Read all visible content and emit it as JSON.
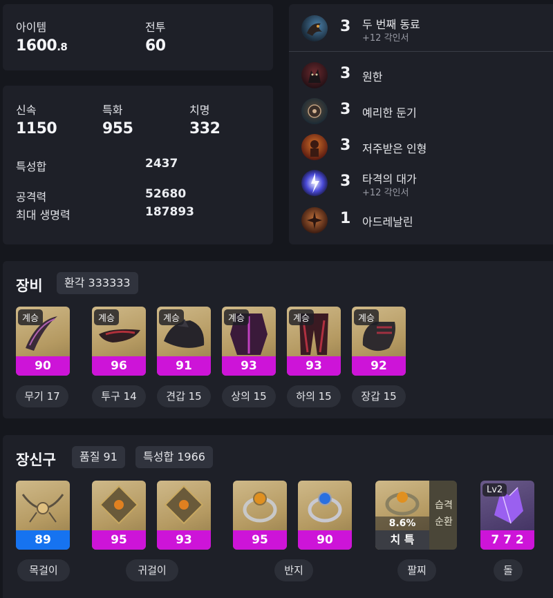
{
  "summary": {
    "item_level_label": "아이템",
    "item_level_main": "1600",
    "item_level_frac": ".8",
    "combat_label": "전투",
    "combat_value": "60"
  },
  "stats": {
    "swiftness_label": "신속",
    "swiftness_value": "1150",
    "specialization_label": "특화",
    "specialization_value": "955",
    "crit_label": "치명",
    "crit_value": "332",
    "total_label": "특성합",
    "total_value": "2437",
    "attack_label": "공격력",
    "attack_value": "52680",
    "hp_label": "최대 생명력",
    "hp_value": "187893"
  },
  "engravings": [
    {
      "level": "3",
      "name": "두 번째 동료",
      "sub": "+12 각인서"
    },
    {
      "level": "3",
      "name": "원한",
      "sub": ""
    },
    {
      "level": "3",
      "name": "예리한 둔기",
      "sub": ""
    },
    {
      "level": "3",
      "name": "저주받은 인형",
      "sub": ""
    },
    {
      "level": "3",
      "name": "타격의 대가",
      "sub": "+12 각인서"
    },
    {
      "level": "1",
      "name": "아드레날린",
      "sub": ""
    }
  ],
  "equipment": {
    "title": "장비",
    "chip": "환각 333333",
    "items": [
      {
        "tag": "계승",
        "quality": "90",
        "label": "무기 17"
      },
      {
        "tag": "계승",
        "quality": "96",
        "label": "투구 14"
      },
      {
        "tag": "계승",
        "quality": "91",
        "label": "견갑 15"
      },
      {
        "tag": "계승",
        "quality": "93",
        "label": "상의 15"
      },
      {
        "tag": "계승",
        "quality": "93",
        "label": "하의 15"
      },
      {
        "tag": "계승",
        "quality": "92",
        "label": "장갑 15"
      }
    ]
  },
  "accessories": {
    "title": "장신구",
    "chip_quality": "품질 91",
    "chip_total": "특성합 1966",
    "necklace": {
      "quality": "89",
      "label": "목걸이"
    },
    "earring1": {
      "quality": "95"
    },
    "earring2": {
      "quality": "93"
    },
    "earring_label": "귀걸이",
    "ring1": {
      "quality": "95"
    },
    "ring2": {
      "quality": "90"
    },
    "ring_label": "반지",
    "bracelet": {
      "pct": "8.6%",
      "stats": "치 특",
      "side1": "습격",
      "side2": "순환",
      "label": "팔찌"
    },
    "stone": {
      "tag": "Lv2",
      "value": "7 7 2",
      "label": "돌"
    }
  },
  "colors": {
    "quality_purple": "#cd14d8",
    "quality_blue": "#1673f0",
    "panel_bg": "#1e2028",
    "page_bg": "#15171d"
  }
}
